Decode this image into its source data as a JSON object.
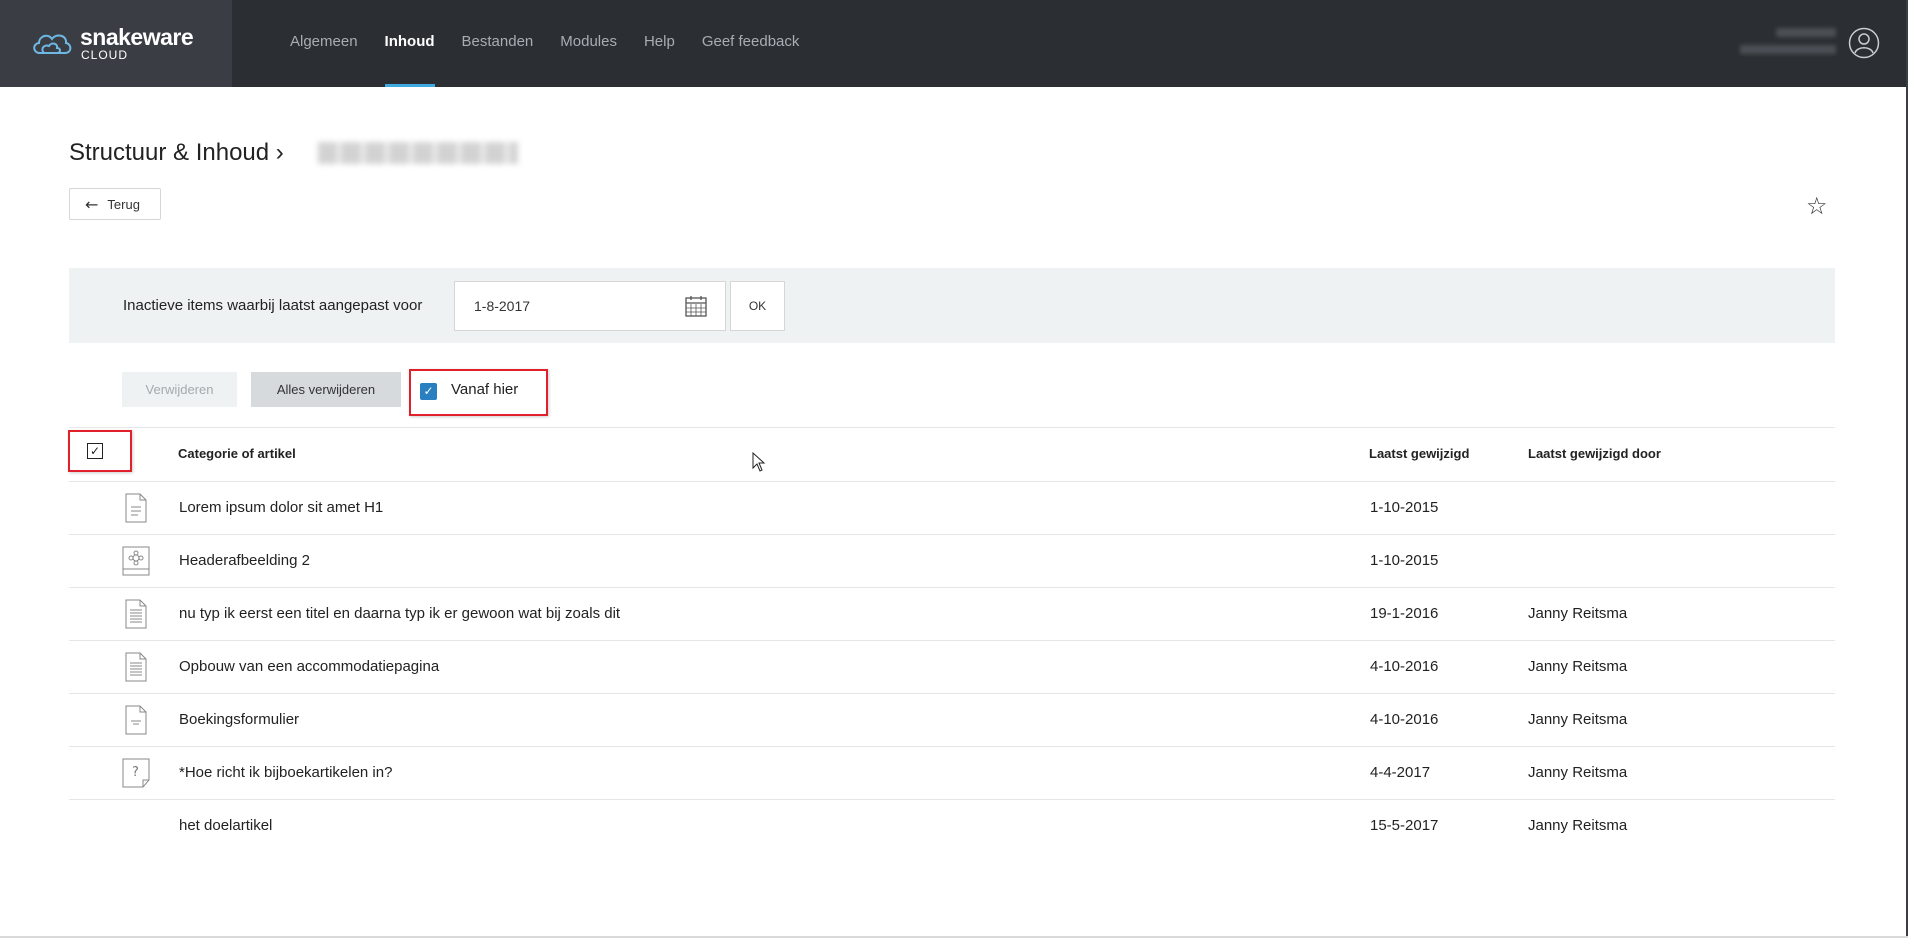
{
  "brand": {
    "name": "snakeware",
    "sub": "CLOUD"
  },
  "nav": [
    {
      "label": "Algemeen",
      "active": false
    },
    {
      "label": "Inhoud",
      "active": true
    },
    {
      "label": "Bestanden",
      "active": false
    },
    {
      "label": "Modules",
      "active": false
    },
    {
      "label": "Help",
      "active": false
    },
    {
      "label": "Geef feedback",
      "active": false
    }
  ],
  "page": {
    "title": "Structuur & Inhoud ›",
    "back_label": "Terug",
    "arrow": "←",
    "star": "☆"
  },
  "filter": {
    "label": "Inactieve items waarbij laatst aangepast voor",
    "date_value": "1-8-2017",
    "ok_label": "OK"
  },
  "actions": {
    "delete_label": "Verwijderen",
    "delete_all_label": "Alles verwijderen",
    "from_here_label": "Vanaf hier",
    "from_here_checked": true,
    "check_mark": "✓"
  },
  "table": {
    "headers": {
      "name": "Categorie of artikel",
      "modified": "Laatst gewijzigd",
      "modified_by": "Laatst gewijzigd door"
    },
    "select_all_checked": true,
    "rows": [
      {
        "icon": "document-icon",
        "name": "Lorem ipsum dolor sit amet H1",
        "modified": "1-10-2015",
        "modified_by": ""
      },
      {
        "icon": "image-icon",
        "name": "Headerafbeelding 2",
        "modified": "1-10-2015",
        "modified_by": ""
      },
      {
        "icon": "text-document-icon",
        "name": "nu typ ik eerst een titel en daarna typ ik er gewoon wat bij zoals dit",
        "modified": "19-1-2016",
        "modified_by": "Janny Reitsma"
      },
      {
        "icon": "text-document-icon",
        "name": "Opbouw van een accommodatiepagina",
        "modified": "4-10-2016",
        "modified_by": "Janny Reitsma"
      },
      {
        "icon": "form-icon",
        "name": "Boekingsformulier",
        "modified": "4-10-2016",
        "modified_by": "Janny Reitsma"
      },
      {
        "icon": "question-document-icon",
        "name": "*Hoe richt ik bijboekartikelen in?",
        "modified": "4-4-2017",
        "modified_by": "Janny Reitsma"
      },
      {
        "icon": "",
        "name": "het doelartikel",
        "modified": "15-5-2017",
        "modified_by": "Janny Reitsma"
      }
    ]
  },
  "colors": {
    "accent": "#3fa9e0",
    "highlight": "#e0202a",
    "checkbox": "#2a7fc1",
    "topbar": "#2b2e33"
  }
}
